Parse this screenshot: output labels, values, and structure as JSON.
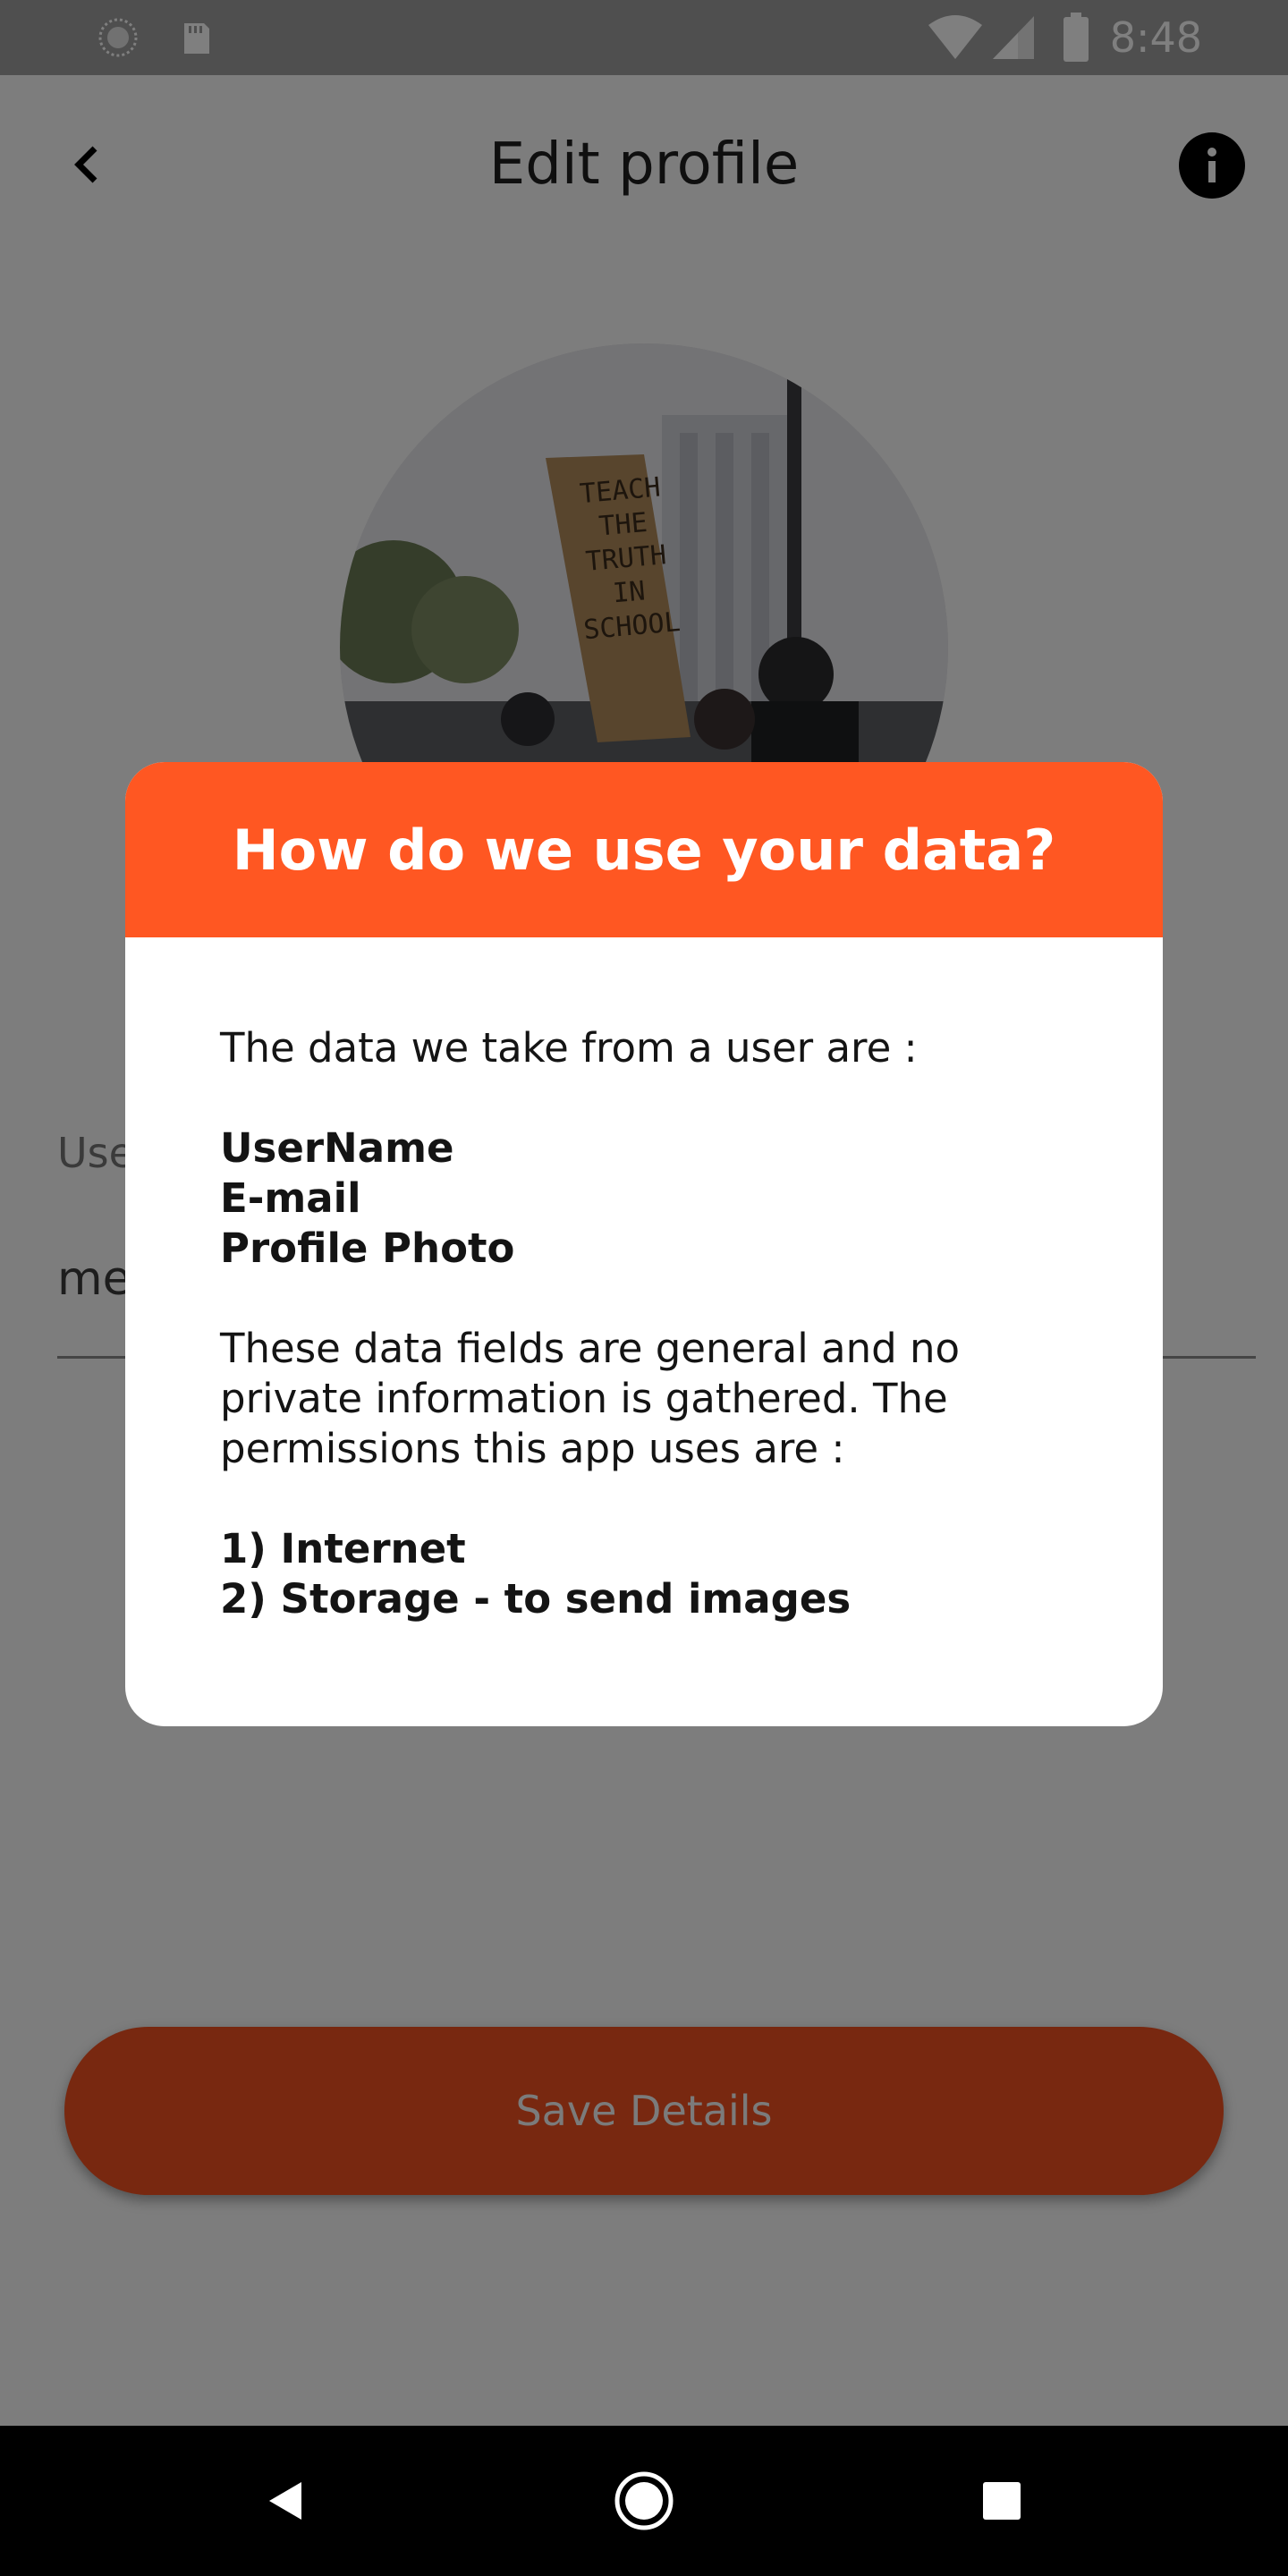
{
  "status_bar": {
    "time": "8:48",
    "icons": [
      "sync-icon",
      "sd-card-icon",
      "wifi-icon",
      "cellular-signal-icon",
      "battery-icon"
    ]
  },
  "header": {
    "title": "Edit profile",
    "back_icon": "chevron-left-icon",
    "info_icon": "info-icon"
  },
  "avatar": {
    "sign_text": [
      "TEACH",
      "THE",
      "TRUTH",
      "IN",
      "SCHOOL"
    ]
  },
  "form": {
    "username_label": "Use",
    "username_value": "me"
  },
  "save_button": {
    "label": "Save Details"
  },
  "dialog": {
    "title": "How do we use your data?",
    "intro": "The data we take from a user are :",
    "data_fields": [
      "UserName",
      "E-mail",
      "Profile Photo"
    ],
    "explanation_lines": [
      "These data fields are general and no",
      "private information is gathered. The",
      "permissions this app uses are :"
    ],
    "permissions": [
      "1) Internet",
      "2) Storage - to send images"
    ]
  },
  "nav_bar": {
    "icons": [
      "back-triangle-icon",
      "home-circle-icon",
      "recents-square-icon"
    ]
  },
  "colors": {
    "accent": "#ff5722",
    "scrim": "#000000",
    "save_button": "#f05020"
  }
}
